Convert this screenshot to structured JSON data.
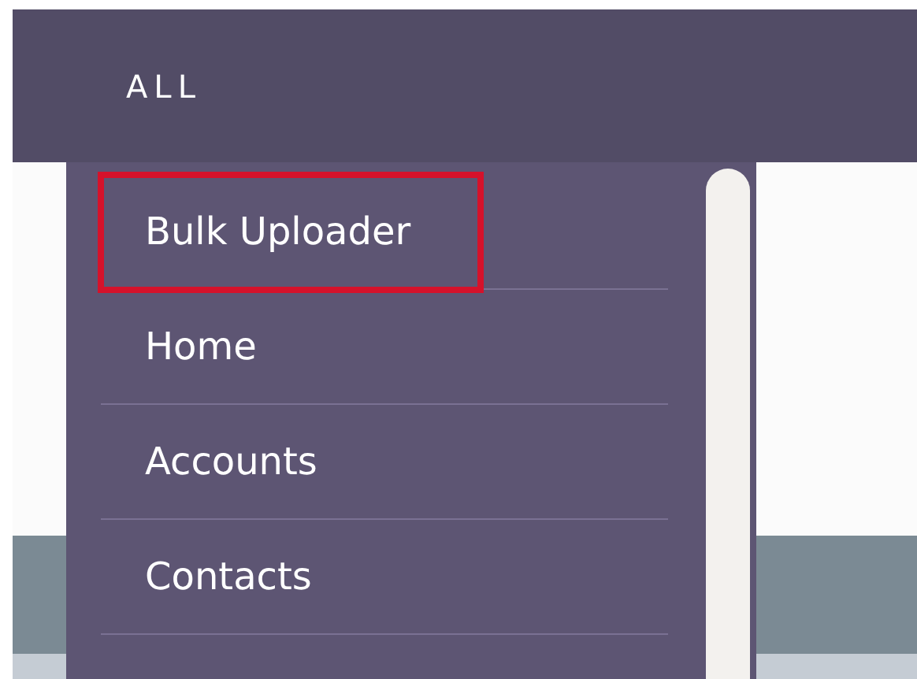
{
  "header": {
    "label": "ALL"
  },
  "menu": {
    "items": [
      {
        "label": "Bulk Uploader",
        "highlighted": true
      },
      {
        "label": "Home",
        "highlighted": false
      },
      {
        "label": "Accounts",
        "highlighted": false
      },
      {
        "label": "Contacts",
        "highlighted": false
      }
    ]
  }
}
